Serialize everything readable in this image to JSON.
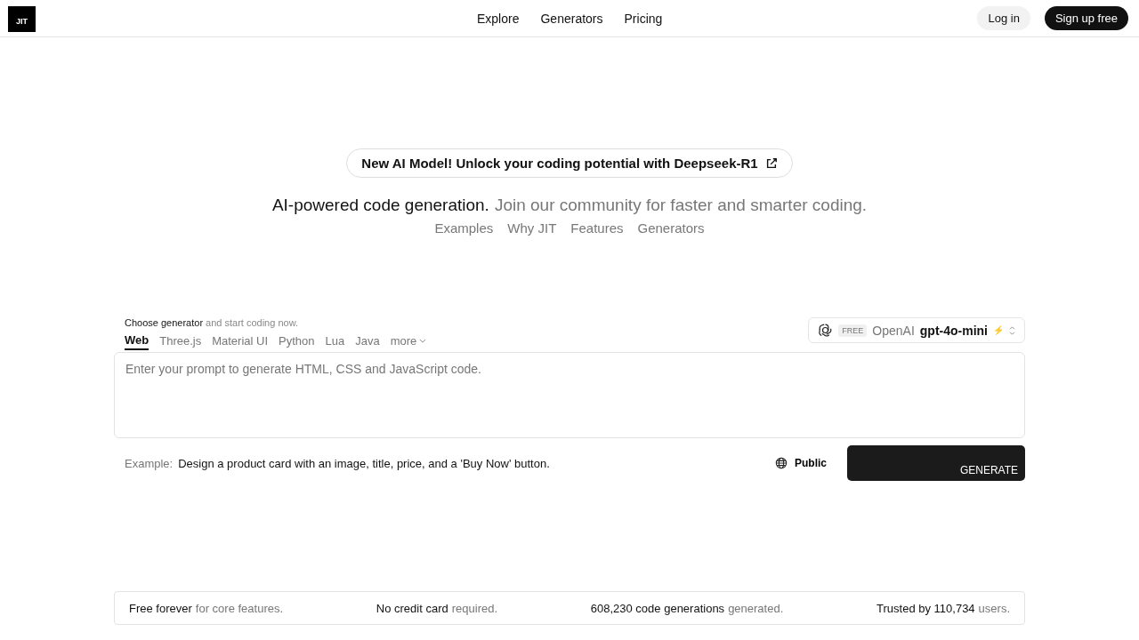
{
  "logo": "JIT",
  "nav": [
    {
      "label": "Explore"
    },
    {
      "label": "Generators"
    },
    {
      "label": "Pricing"
    }
  ],
  "auth": {
    "login": "Log in",
    "signup": "Sign up free"
  },
  "announcement": "New AI Model! Unlock your coding potential with Deepseek-R1",
  "tagline": {
    "main": "AI-powered code generation.",
    "rest": "Join our community for faster and smarter coding."
  },
  "section_links": [
    {
      "label": "Examples"
    },
    {
      "label": "Why JIT"
    },
    {
      "label": "Features"
    },
    {
      "label": "Generators"
    }
  ],
  "chooser": {
    "main": "Choose generator",
    "rest": "and start coding now."
  },
  "tabs": [
    {
      "label": "Web",
      "selected": true
    },
    {
      "label": "Three.js",
      "selected": false
    },
    {
      "label": "Material UI",
      "selected": false
    },
    {
      "label": "Python",
      "selected": false
    },
    {
      "label": "Lua",
      "selected": false
    },
    {
      "label": "Java",
      "selected": false
    }
  ],
  "more": "more",
  "model": {
    "badge": "FREE",
    "provider": "OpenAI",
    "name": "gpt-4o-mini",
    "bolt": "⚡"
  },
  "prompt": {
    "placeholder": "Enter your prompt to generate HTML, CSS and JavaScript code."
  },
  "example": {
    "label": "Example:",
    "text": "Design a product card with an image, title, price, and a 'Buy Now' button."
  },
  "visibility": "Public",
  "generate": "GENERATE",
  "features": [
    {
      "main": "Free forever",
      "rest": "for core features."
    },
    {
      "main": "No credit card",
      "rest": "required."
    },
    {
      "main": "608,230 code generations",
      "rest": "generated."
    },
    {
      "main": "Trusted by 110,734",
      "rest": "users."
    }
  ]
}
